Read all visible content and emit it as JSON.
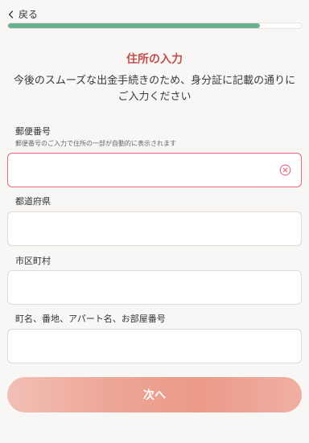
{
  "header": {
    "back_label": "戻る",
    "progress_percent": 86
  },
  "page": {
    "title": "住所の入力",
    "description": "今後のスムーズな出金手続きのため、身分証に記載の通りにご入力ください"
  },
  "fields": {
    "postal_code": {
      "label": "郵便番号",
      "hint": "郵便番号のご入力で住所の一部が自動的に表示されます",
      "value": ""
    },
    "prefecture": {
      "label": "都道府県",
      "value": ""
    },
    "city": {
      "label": "市区町村",
      "value": ""
    },
    "street": {
      "label": "町名、番地、アパート名、お部屋番号",
      "value": ""
    }
  },
  "actions": {
    "next_label": "次へ"
  },
  "colors": {
    "accent": "#c0504d",
    "progress": "#6cb08f",
    "active_border": "#e36a80",
    "button": "#ec9a88"
  },
  "icons": {
    "back": "chevron-left-icon",
    "clear": "clear-circle-icon"
  }
}
